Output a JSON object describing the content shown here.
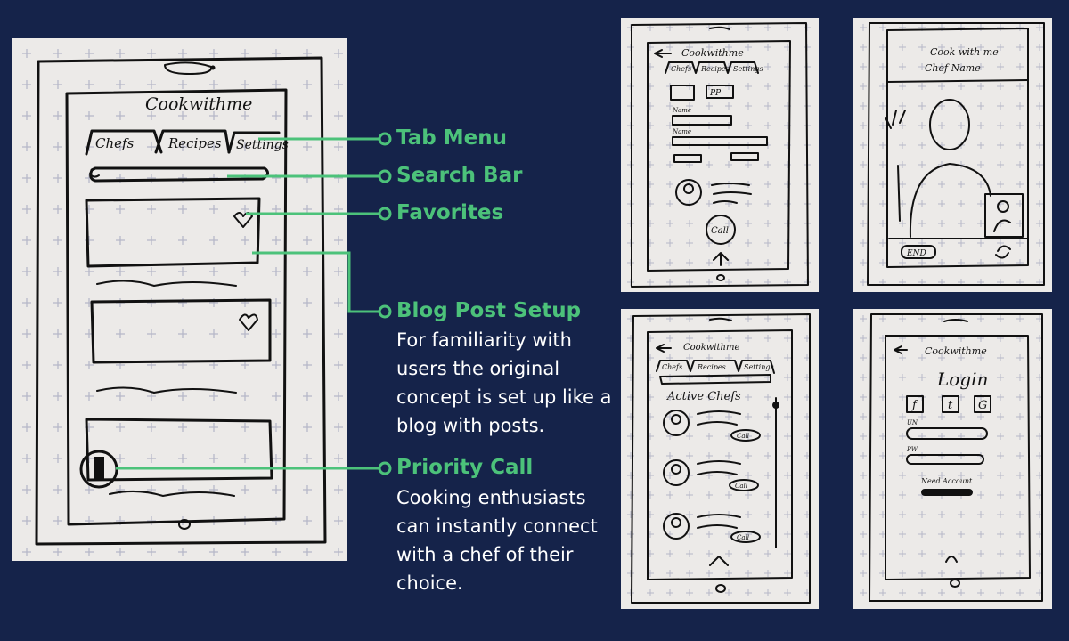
{
  "main_sketch": {
    "app_title": "Cookwithme",
    "tabs": [
      "Chefs",
      "Recipes",
      "Settings"
    ]
  },
  "annotations": [
    {
      "title": "Tab Menu",
      "body": ""
    },
    {
      "title": "Search Bar",
      "body": ""
    },
    {
      "title": "Favorites",
      "body": ""
    },
    {
      "title": "Blog Post Setup",
      "body": "For familiarity with users the original concept is set up like a blog with posts."
    },
    {
      "title": "Priority Call",
      "body": "Cooking enthusiasts can instantly connect with a chef of their choice."
    }
  ],
  "profile_sketch": {
    "title": "Cookwithme",
    "tabs": [
      "Chefs",
      "Recipes",
      "Settings"
    ],
    "field_labels": [
      "Name",
      "Name"
    ],
    "call_button": "Call"
  },
  "video_sketch": {
    "title": "Cook with me",
    "subtitle": "Chef Name",
    "end_button": "END"
  },
  "chefs_sketch": {
    "title": "Cookwithme",
    "tabs": [
      "Chefs",
      "Recipes",
      "Settings"
    ],
    "heading": "Active Chefs",
    "call_button": "Call"
  },
  "login_sketch": {
    "title": "Cookwithme",
    "heading": "Login",
    "social": [
      "f",
      "t",
      "G"
    ],
    "field_labels": [
      "UN",
      "PW"
    ],
    "link": "Need Account"
  },
  "colors": {
    "background": "#15234a",
    "accent": "#4cc27a",
    "paper": "#eceae8"
  }
}
